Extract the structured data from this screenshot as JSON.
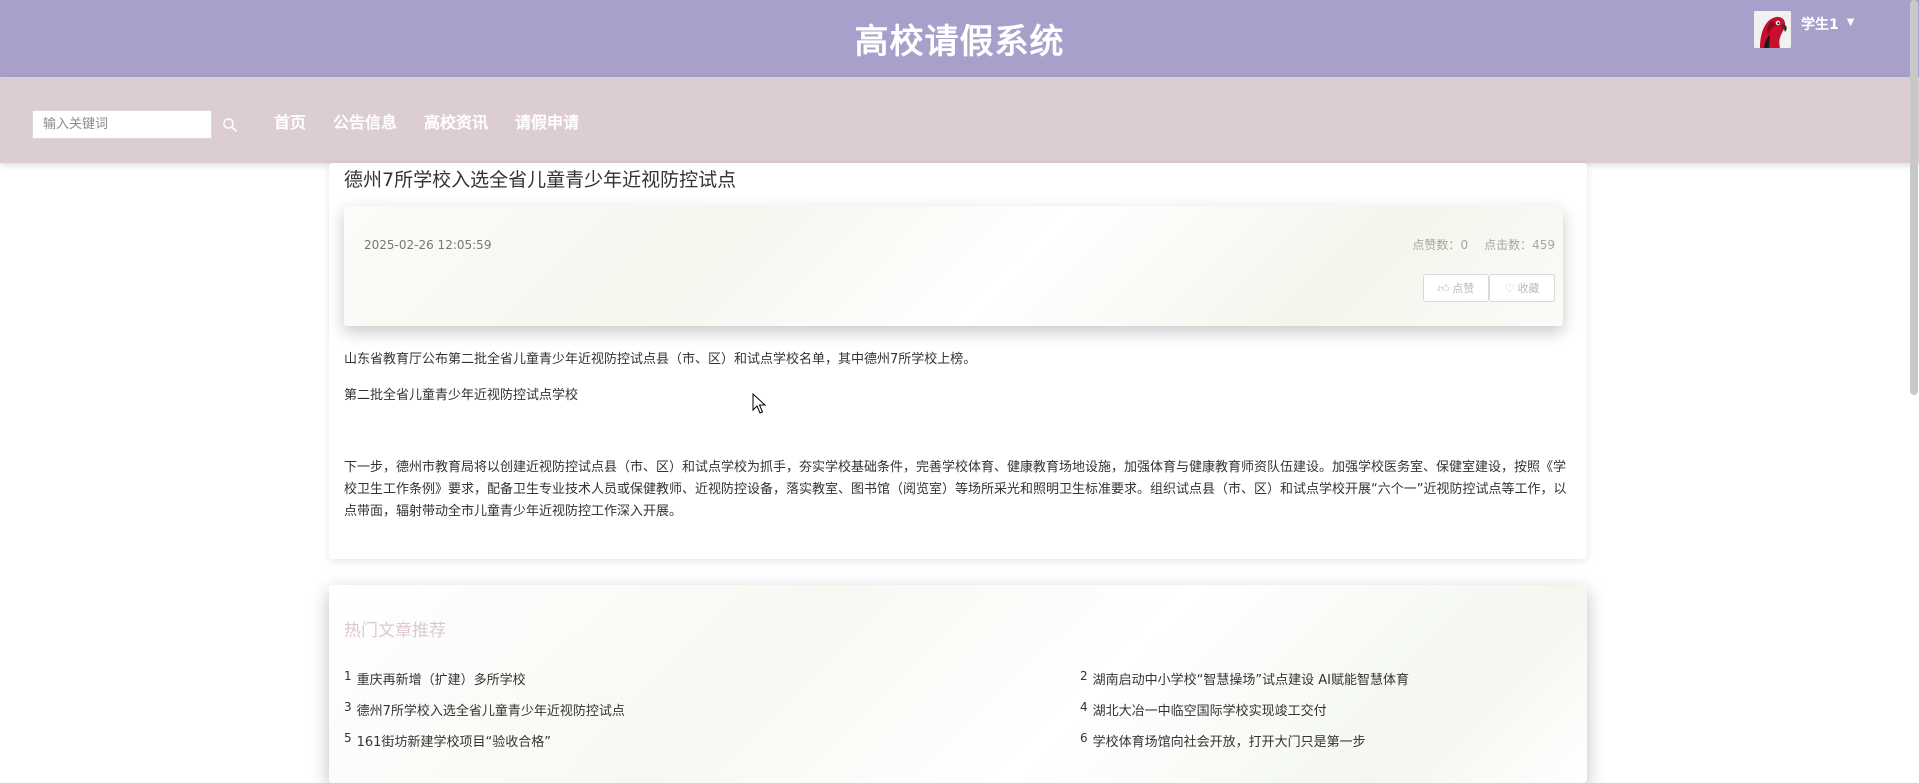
{
  "header": {
    "title": "高校请假系统",
    "user": {
      "name": "学生1",
      "avatar_icon": "red-parrot-avatar",
      "menu_icon": "caret-down-icon"
    },
    "background_color": "#a89fcb"
  },
  "nav": {
    "search_placeholder": "输入关键词",
    "search_icon": "magnifier-icon",
    "links": [
      "首页",
      "公告信息",
      "高校资讯",
      "请假申请"
    ],
    "background_color": "#dbcdd3"
  },
  "article": {
    "title": "德州7所学校入选全省儿童青少年近视防控试点",
    "date": "2025-02-26 12:05:59",
    "likes_label": "点赞数：",
    "likes_value": "0",
    "clicks_label": "点击数：",
    "clicks_value": "459",
    "like_button": "点赞",
    "like_icon": "thumbs-up-icon",
    "favorite_button": "收藏",
    "favorite_icon": "heart-icon",
    "paragraphs": [
      "山东省教育厅公布第二批全省儿童青少年近视防控试点县（市、区）和试点学校名单，其中德州7所学校上榜。",
      "第二批全省儿童青少年近视防控试点学校",
      "下一步，德州市教育局将以创建近视防控试点县（市、区）和试点学校为抓手，夯实学校基础条件，完善学校体育、健康教育场地设施，加强体育与健康教育师资队伍建设。加强学校医务室、保健室建设，按照《学校卫生工作条例》要求，配备卫生专业技术人员或保健教师、近视防控设备，落实教室、图书馆（阅览室）等场所采光和照明卫生标准要求。组织试点县（市、区）和试点学校开展“六个一”近视防控试点等工作，以点带面，辐射带动全市儿童青少年近视防控工作深入开展。"
    ]
  },
  "hot_articles": {
    "title": "热门文章推荐",
    "items": [
      {
        "num": "1",
        "text": "重庆再新增（扩建）多所学校"
      },
      {
        "num": "2",
        "text": "湖南启动中小学校“智慧操场”试点建设 AI赋能智慧体育"
      },
      {
        "num": "3",
        "text": "德州7所学校入选全省儿童青少年近视防控试点"
      },
      {
        "num": "4",
        "text": "湖北大冶一中临空国际学校实现竣工交付"
      },
      {
        "num": "5",
        "text": "161街坊新建学校项目“验收合格”"
      },
      {
        "num": "6",
        "text": "学校体育场馆向社会开放，打开大门只是第一步"
      }
    ]
  }
}
